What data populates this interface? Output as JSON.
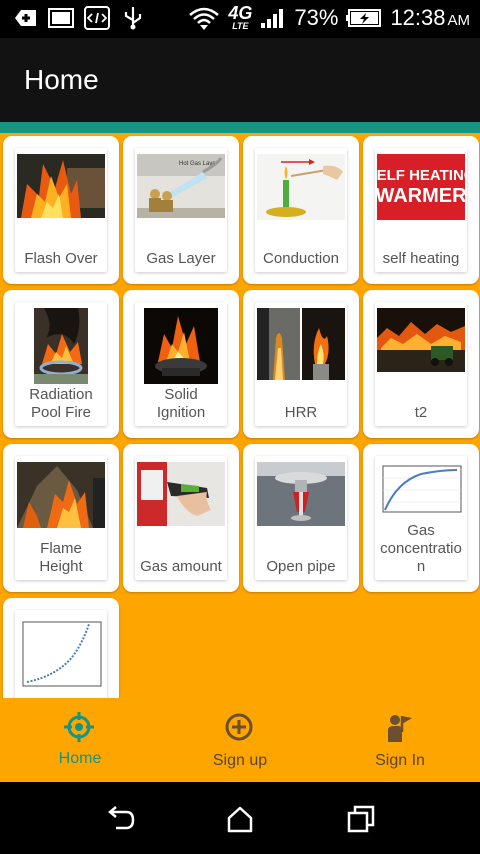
{
  "status_bar": {
    "network_label": "4G",
    "network_sub": "LTE",
    "battery": "73%",
    "time": "12:38",
    "ampm": "AM"
  },
  "app_bar": {
    "title": "Home"
  },
  "grid": {
    "items": [
      {
        "label": "Flash Over"
      },
      {
        "label": "Gas Layer",
        "image_text": "Hot Gas Layer"
      },
      {
        "label": "Conduction"
      },
      {
        "label": "self heating",
        "image_text_1": "SELF HEATING",
        "image_text_2": "WARMER"
      },
      {
        "label_1": "Radiation",
        "label_2": "Pool Fire"
      },
      {
        "label_1": "Solid",
        "label_2": "Ignition"
      },
      {
        "label": "HRR"
      },
      {
        "label": "t2"
      },
      {
        "label_1": "Flame",
        "label_2": "Height"
      },
      {
        "label": "Gas amount"
      },
      {
        "label": "Open pipe"
      },
      {
        "label_1": "Gas",
        "label_2": "concentratio",
        "label_3": "n"
      },
      {
        "label": ""
      }
    ]
  },
  "bottom_nav": {
    "items": [
      {
        "label": "Home",
        "icon": "crosshair-icon"
      },
      {
        "label": "Sign up",
        "icon": "plus-circle-icon"
      },
      {
        "label": "Sign In",
        "icon": "person-flag-icon"
      }
    ]
  },
  "colors": {
    "accent": "#169484",
    "background": "#FFA500",
    "app_bar": "#121212"
  }
}
